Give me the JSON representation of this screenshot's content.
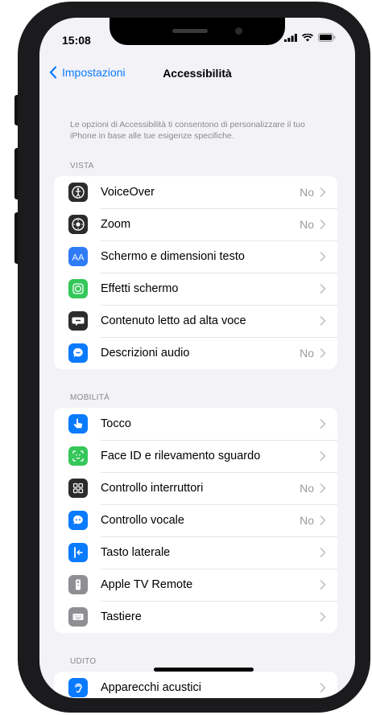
{
  "status": {
    "time": "15:08"
  },
  "nav": {
    "back_label": "Impostazioni",
    "title": "Accessibilità"
  },
  "intro": "Le opzioni di Accessibilità ti consentono di personalizzare il tuo iPhone in base alle tue esigenze specifiche.",
  "sections": [
    {
      "header": "VISTA",
      "items": [
        {
          "label": "VoiceOver",
          "value": "No",
          "icon": "voiceover-icon",
          "color": "#2c2c2e"
        },
        {
          "label": "Zoom",
          "value": "No",
          "icon": "zoom-icon",
          "color": "#2c2c2e"
        },
        {
          "label": "Schermo e dimensioni testo",
          "value": "",
          "icon": "text-size-icon",
          "color": "#2f7cf6"
        },
        {
          "label": "Effetti schermo",
          "value": "",
          "icon": "motion-icon",
          "color": "#34c759"
        },
        {
          "label": "Contenuto letto ad alta voce",
          "value": "",
          "icon": "spoken-content-icon",
          "color": "#2c2c2e"
        },
        {
          "label": "Descrizioni audio",
          "value": "No",
          "icon": "audio-descriptions-icon",
          "color": "#0a7aff"
        }
      ]
    },
    {
      "header": "MOBILITÀ",
      "items": [
        {
          "label": "Tocco",
          "value": "",
          "icon": "touch-icon",
          "color": "#0a7aff"
        },
        {
          "label": "Face ID e rilevamento sguardo",
          "value": "",
          "icon": "face-id-icon",
          "color": "#34c759"
        },
        {
          "label": "Controllo interruttori",
          "value": "No",
          "icon": "switch-control-icon",
          "color": "#2c2c2e"
        },
        {
          "label": "Controllo vocale",
          "value": "No",
          "icon": "voice-control-icon",
          "color": "#0a7aff"
        },
        {
          "label": "Tasto laterale",
          "value": "",
          "icon": "side-button-icon",
          "color": "#0a7aff"
        },
        {
          "label": "Apple TV Remote",
          "value": "",
          "icon": "tv-remote-icon",
          "color": "#8e8e93"
        },
        {
          "label": "Tastiere",
          "value": "",
          "icon": "keyboard-icon",
          "color": "#8e8e93"
        }
      ]
    },
    {
      "header": "UDITO",
      "items": [
        {
          "label": "Apparecchi acustici",
          "value": "",
          "icon": "hearing-devices-icon",
          "color": "#0a7aff"
        }
      ]
    }
  ]
}
